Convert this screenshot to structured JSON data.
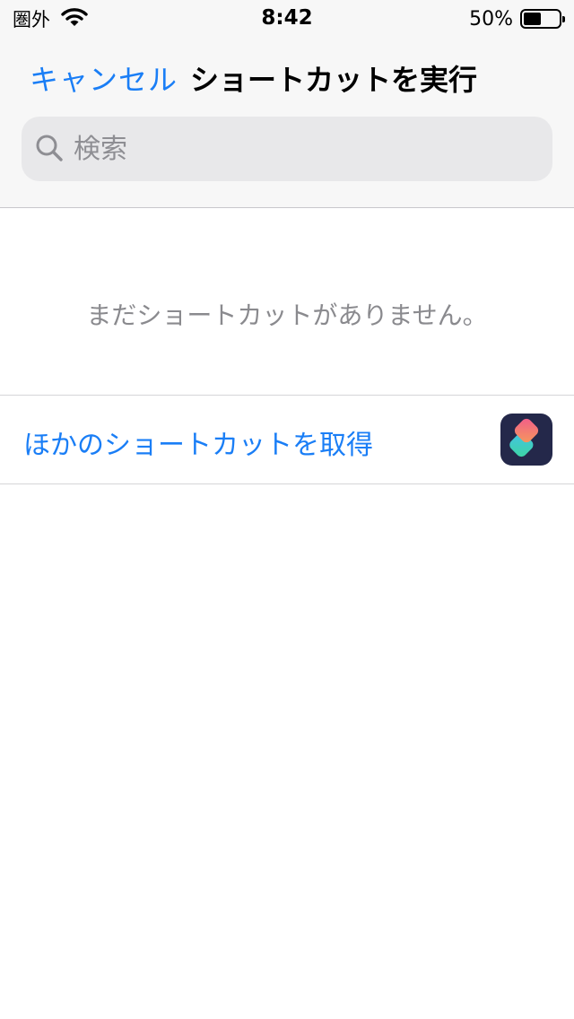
{
  "status_bar": {
    "carrier": "圏外",
    "time": "8:42",
    "battery_percent": "50%",
    "battery_level": 0.5,
    "wifi_icon": "wifi-icon",
    "battery_icon": "battery-icon"
  },
  "nav": {
    "cancel_label": "キャンセル",
    "title": "ショートカットを実行"
  },
  "search": {
    "placeholder": "検索",
    "value": "",
    "icon": "search-icon"
  },
  "main": {
    "empty_message": "まだショートカットがありません。",
    "get_more_label": "ほかのショートカットを取得",
    "app_icon": "shortcuts-app-icon"
  },
  "colors": {
    "accent": "#1a7ef6",
    "header_bg": "#f7f7f7",
    "search_bg": "#e8e8ea",
    "secondary_text": "#8a8a8e",
    "app_icon_bg": "#24284a"
  }
}
